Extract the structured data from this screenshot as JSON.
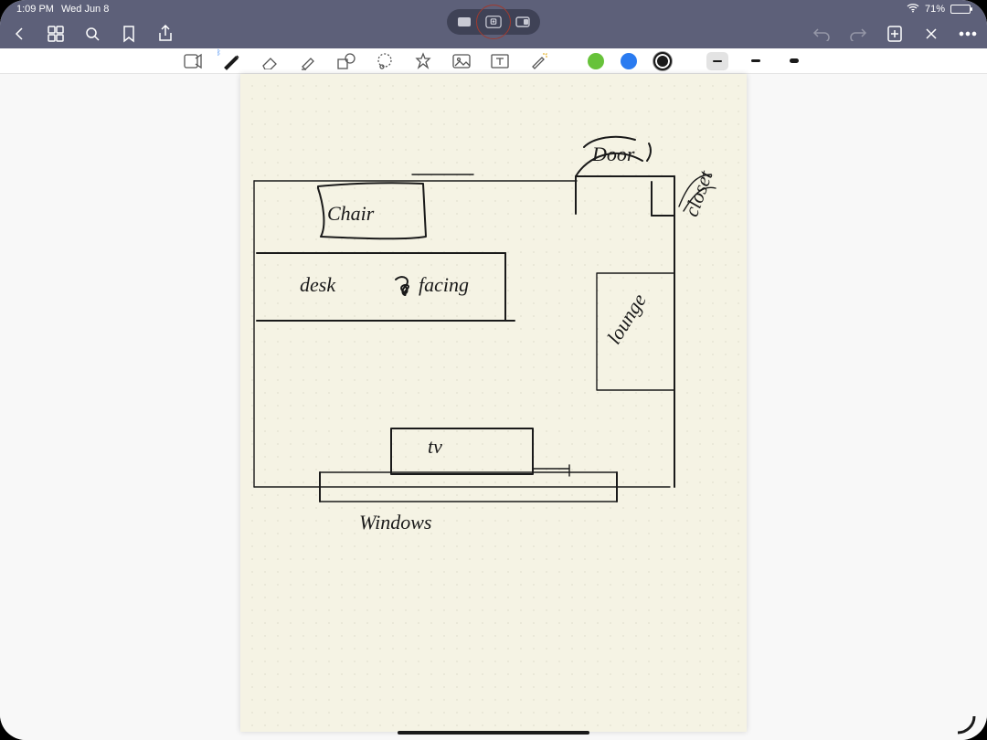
{
  "status": {
    "time": "1:09 PM",
    "date": "Wed Jun 8",
    "battery_pct": "71%",
    "wifi": true
  },
  "nav": {
    "back": "back",
    "documents": "documents",
    "search": "search",
    "bookmark": "bookmark",
    "share": "share",
    "undo": "undo",
    "redo": "redo",
    "add_page": "add_page",
    "close": "close",
    "more": "more"
  },
  "multitask": {
    "full": "fullscreen",
    "split": "split-view",
    "slide": "slideover"
  },
  "toolbar": {
    "readonly": "read-only",
    "pen": "pen",
    "eraser": "eraser",
    "highlighter": "highlighter",
    "shapes": "shapes",
    "lasso": "lasso",
    "stickers": "stickers",
    "image": "image",
    "textbox": "text-box",
    "laser": "laser",
    "colors": {
      "green": "#67c23a",
      "blue": "#2a7bf0",
      "black": "#1a1a1a"
    },
    "selected_color": "black",
    "strokes": [
      "thin",
      "medium",
      "thick"
    ],
    "selected_stroke": "thin"
  },
  "drawing_labels": {
    "door": "Door",
    "closet": "closet",
    "chair": "Chair",
    "desk": "desk",
    "facing": "facing",
    "lounge": "lounge",
    "tv": "tv",
    "windows": "Windows"
  }
}
